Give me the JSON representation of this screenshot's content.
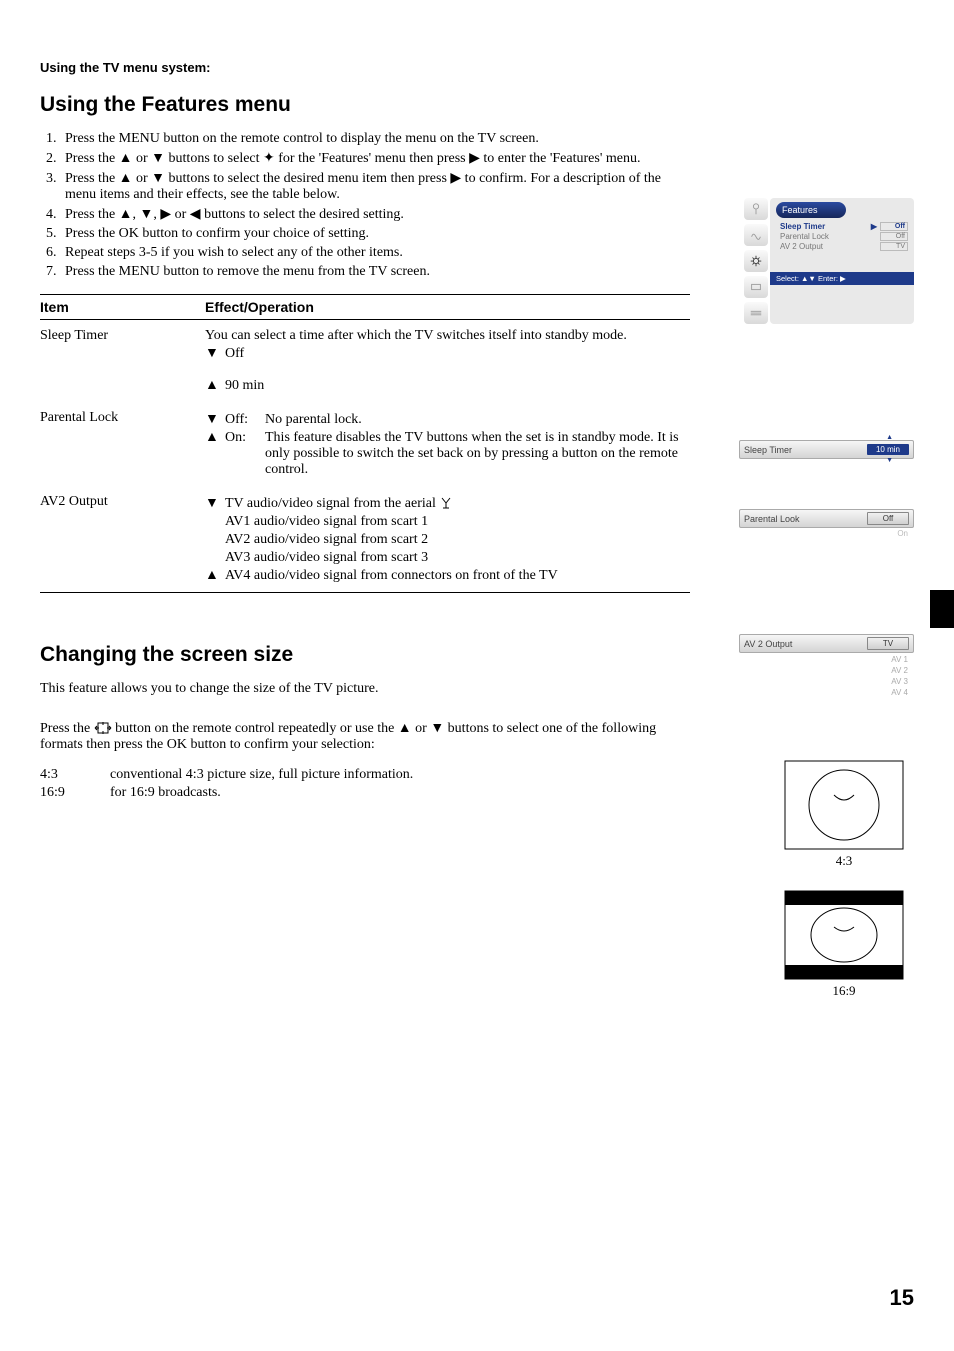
{
  "header": {
    "section": "Using the TV menu system:",
    "title1": "Using the Features menu",
    "title2": "Changing the screen size"
  },
  "steps": [
    "Press the MENU button on the remote control to display the menu on the TV screen.",
    "Press the ▲ or ▼ buttons to select  ✦  for the 'Features' menu then press ▶ to enter the 'Features' menu.",
    "Press the ▲ or ▼ buttons to select the desired menu item then press ▶ to confirm.  For a description of the menu items and their effects, see the table below.",
    "Press the ▲, ▼, ▶ or ◀ buttons to select the desired setting.",
    "Press the OK button to confirm your choice of setting.",
    "Repeat steps 3-5 if you wish to select any of the other items.",
    "Press the MENU button to remove the menu from the TV screen."
  ],
  "table": {
    "head_item": "Item",
    "head_eff": "Effect/Operation",
    "rows": {
      "sleep": {
        "item": "Sleep Timer",
        "desc": "You can select a time after which the TV switches itself into standby mode.",
        "down": "Off",
        "up": "90 min"
      },
      "parental": {
        "item": "Parental Lock",
        "off_key": "Off:",
        "off_text": "No parental lock.",
        "on_key": "On:",
        "on_text": "This feature disables the TV buttons when the set is in standby mode. It is only possible to switch the set back on by pressing a button on the remote control."
      },
      "av2": {
        "item": "AV2 Output",
        "tv": "TV audio/video signal from the aerial",
        "av1": "AV1 audio/video signal from scart 1",
        "av2": "AV2 audio/video signal from scart 2",
        "av3": "AV3 audio/video signal from scart 3",
        "av4": "AV4 audio/video signal from connectors on front of the TV"
      }
    }
  },
  "change_size": {
    "intro": "This feature allows you to change the size of the TV picture.",
    "instr_a": "Press the ",
    "instr_b": " button on the remote control repeatedly or use the ▲ or ▼ buttons to select one of the following formats then press the OK button to confirm your selection:",
    "formats": {
      "f43_key": "4:3",
      "f43_val": "conventional 4:3 picture size, full picture information.",
      "f169_key": "16:9",
      "f169_val": "for 16:9 broadcasts."
    }
  },
  "osd": {
    "features_title": "Features",
    "sleep_label": "Sleep Timer",
    "sleep_val": "Off",
    "parental_label": "Parental Lock",
    "parental_val": "Off",
    "av2_label": "AV 2 Output",
    "av2_val": "TV",
    "footer": "Select: ▲▼ Enter: ▶",
    "bar_sleep_label": "Sleep Timer",
    "bar_sleep_val": "10 min",
    "bar_parental_label": "Parental Look",
    "bar_parental_val": "Off",
    "bar_parental_on": "On",
    "bar_av2_label": "AV 2 Output",
    "bar_av2_val": "TV",
    "av2_opts": [
      "AV 1",
      "AV 2",
      "AV 3",
      "AV 4"
    ]
  },
  "sketches": {
    "cap43": "4:3",
    "cap169": "16:9"
  },
  "page_number": "15"
}
